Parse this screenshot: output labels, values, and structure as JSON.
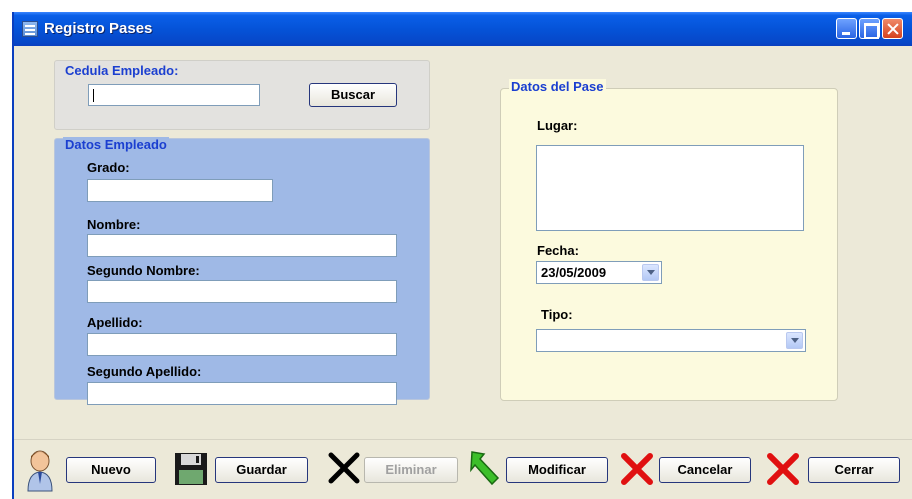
{
  "window": {
    "title": "Registro Pases"
  },
  "cedula": {
    "legend": "Cedula Empleado:",
    "value": "",
    "search_label": "Buscar"
  },
  "empleado": {
    "legend": "Datos Empleado",
    "grado_label": "Grado:",
    "nombre_label": "Nombre:",
    "segundo_nombre_label": "Segundo Nombre:",
    "apellido_label": "Apellido:",
    "segundo_apellido_label": "Segundo Apellido:"
  },
  "pase": {
    "legend": "Datos del Pase",
    "lugar_label": "Lugar:",
    "fecha_label": "Fecha:",
    "fecha_value": "23/05/2009",
    "tipo_label": "Tipo:",
    "tipo_value": ""
  },
  "toolbar": {
    "nuevo": "Nuevo",
    "guardar": "Guardar",
    "eliminar": "Eliminar",
    "modificar": "Modificar",
    "cancelar": "Cancelar",
    "cerrar": "Cerrar"
  },
  "colors": {
    "title_bar": "#0553d8",
    "accent_legend": "#1b3fd0",
    "empleado_panel": "#9fb9e6",
    "pase_panel": "#fcfade",
    "delete_x": "#e01010"
  },
  "icons": [
    "user-icon",
    "floppy-disk-icon",
    "black-x-icon",
    "green-arrow-icon",
    "red-x-icon"
  ]
}
